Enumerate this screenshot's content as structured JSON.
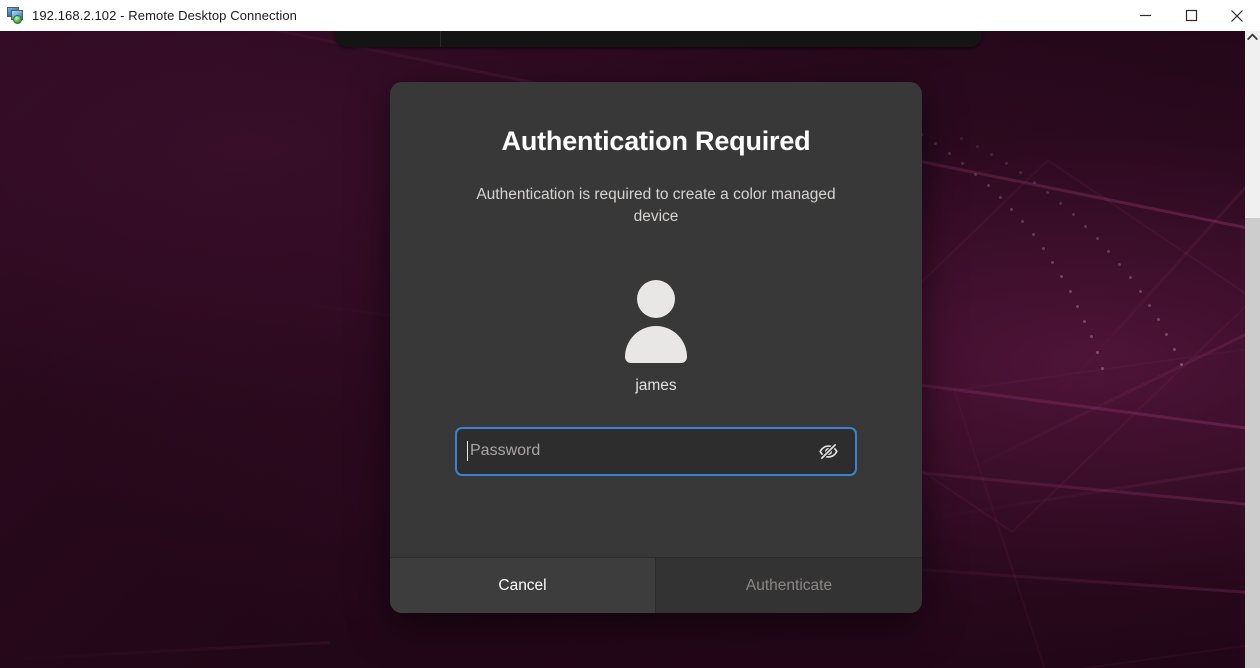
{
  "window": {
    "title": "192.168.2.102 - Remote Desktop Connection",
    "icon": "remote-desktop-icon",
    "controls": {
      "minimize": "minimize-icon",
      "maximize": "maximize-icon",
      "close": "close-icon"
    }
  },
  "desktop": {
    "wallpaper_colors": {
      "base": "#25081a",
      "accent": "#a84080",
      "highlight": "#782056"
    },
    "topbar_color": "#141414"
  },
  "dialog": {
    "title": "Authentication Required",
    "message": "Authentication is required to create a color managed device",
    "avatar_icon": "user-avatar-icon",
    "username": "james",
    "password": {
      "value": "",
      "placeholder": "Password",
      "reveal_icon": "eye-slash-icon",
      "focus_color": "#3b82d6"
    },
    "buttons": {
      "cancel": "Cancel",
      "authenticate": "Authenticate"
    },
    "background_color": "#383838"
  },
  "scrollbar": {
    "up_icon": "chevron-up-icon",
    "thumb_color": "#f0f0f0",
    "track_color": "#cdcdcd"
  }
}
